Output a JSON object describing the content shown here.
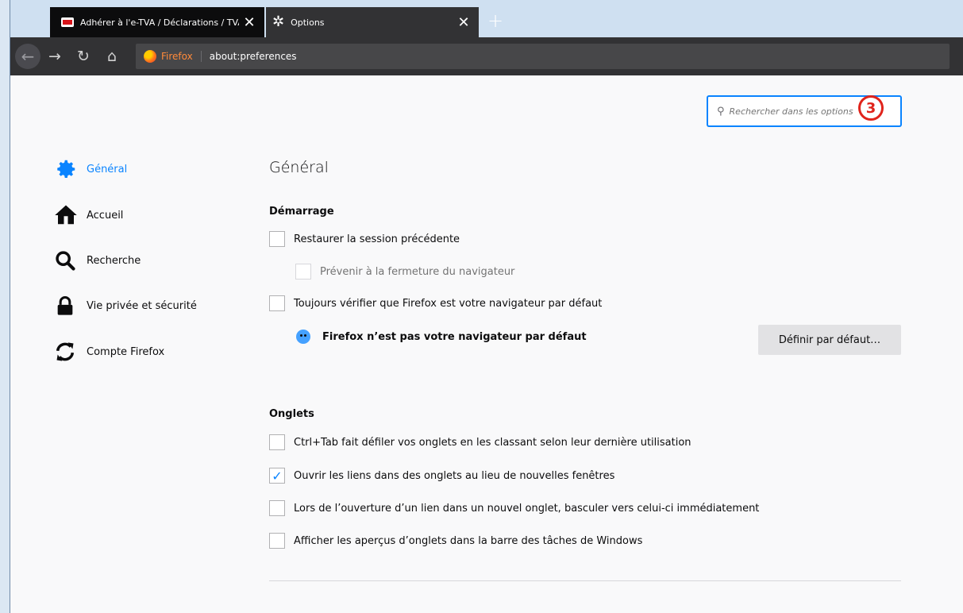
{
  "tabs": [
    {
      "title": "Adhérer à l'e-TVA / Déclarations / TVA",
      "close": "✕"
    },
    {
      "title": "Options",
      "close": "✕"
    }
  ],
  "new_tab": "+",
  "nav": {
    "back": "←",
    "forward": "→",
    "reload": "↻",
    "home": "⌂",
    "identity_label": "Firefox",
    "url": "about:preferences"
  },
  "search": {
    "placeholder": "Rechercher dans les options",
    "icon": "⚲"
  },
  "annotation_badge": "3",
  "sidebar": {
    "items": [
      {
        "label": "Général",
        "icon": "gear-icon"
      },
      {
        "label": "Accueil",
        "icon": "home-icon"
      },
      {
        "label": "Recherche",
        "icon": "search-icon"
      },
      {
        "label": "Vie privée et sécurité",
        "icon": "lock-icon"
      },
      {
        "label": "Compte Firefox",
        "icon": "sync-icon"
      }
    ]
  },
  "main": {
    "title": "Général",
    "startup": {
      "heading": "Démarrage",
      "options": [
        {
          "label": "Restaurer la session précédente",
          "checked": false,
          "disabled": false
        },
        {
          "label": "Prévenir à la fermeture du navigateur",
          "checked": false,
          "disabled": true
        },
        {
          "label": "Toujours vérifier que Firefox est votre navigateur par défaut",
          "checked": false,
          "disabled": false
        }
      ],
      "default_warning": "Firefox n’est pas votre navigateur par défaut",
      "default_button": "Définir par défaut…"
    },
    "tabs_section": {
      "heading": "Onglets",
      "options": [
        {
          "label": "Ctrl+Tab fait défiler vos onglets en les classant selon leur dernière utilisation",
          "checked": false
        },
        {
          "label": "Ouvrir les liens dans des onglets au lieu de nouvelles fenêtres",
          "checked": true
        },
        {
          "label": "Lors de l’ouverture d’un lien dans un nouvel onglet, basculer vers celui-ci immédiatement",
          "checked": false
        },
        {
          "label": "Afficher les aperçus d’onglets dans la barre des tâches de Windows",
          "checked": false
        }
      ]
    }
  },
  "colors": {
    "accent": "#0a84ff",
    "annotation": "#e0241c"
  }
}
